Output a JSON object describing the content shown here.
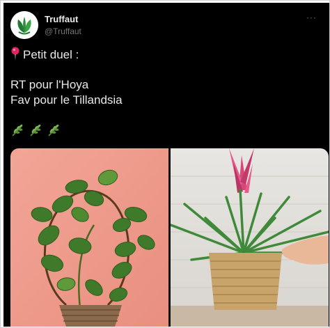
{
  "tweet": {
    "author_name": "Truffaut",
    "author_handle": "@Truffaut",
    "more_label": "···",
    "avatar_icon": "truffaut-leaf-logo",
    "lines": {
      "l1": "Petit duel :",
      "l2": "RT pour l'Hoya",
      "l3": "Fav pour le Tillandsia"
    },
    "line1_icon": "round-pushpin-icon",
    "sprout_icon": "herb-icon",
    "media": {
      "left_image": "hoya-plant-photo",
      "right_image": "tillandsia-plant-photo"
    }
  },
  "colors": {
    "background": "#000000",
    "text": "#e7e9ea",
    "secondary_text": "#71767b",
    "brand_green": "#2e8b3e"
  }
}
